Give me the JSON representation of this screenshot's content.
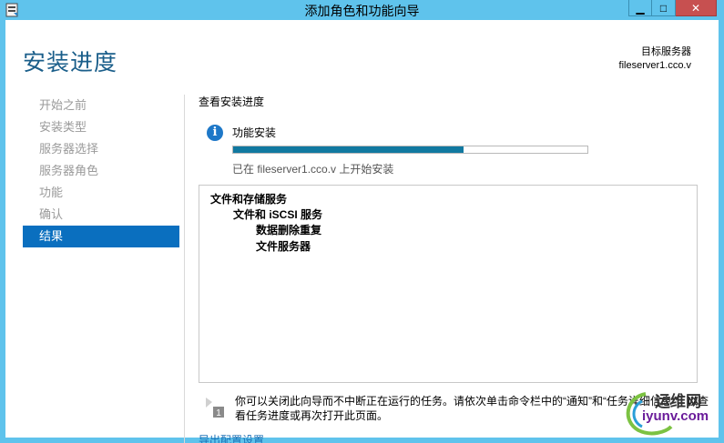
{
  "window": {
    "title": "添加角色和功能向导",
    "minimize_glyph": "▁",
    "maximize_glyph": "□",
    "close_glyph": "✕"
  },
  "header": {
    "page_title": "安装进度",
    "target_label": "目标服务器",
    "target_server": "fileserver1.cco.v"
  },
  "sidebar": {
    "items": [
      {
        "label": "开始之前",
        "active": false
      },
      {
        "label": "安装类型",
        "active": false
      },
      {
        "label": "服务器选择",
        "active": false
      },
      {
        "label": "服务器角色",
        "active": false
      },
      {
        "label": "功能",
        "active": false
      },
      {
        "label": "确认",
        "active": false
      },
      {
        "label": "结果",
        "active": true
      }
    ]
  },
  "main": {
    "section_title": "查看安装进度",
    "info_icon_glyph": "i",
    "progress_label": "功能安装",
    "progress_fraction": 0.65,
    "progress_status": "已在 fileserver1.cco.v 上开始安装",
    "features": [
      {
        "label": "文件和存储服务",
        "level": 0
      },
      {
        "label": "文件和 iSCSI 服务",
        "level": 1
      },
      {
        "label": "数据删除重复",
        "level": 2
      },
      {
        "label": "文件服务器",
        "level": 2
      }
    ],
    "note": "你可以关闭此向导而不中断正在运行的任务。请依次单击命令栏中的“通知”和“任务详细信息”，以查看任务进度或再次打开此页面。",
    "flag_number": "1",
    "export_link": "导出配置设置"
  },
  "watermark": {
    "cn": "运维网",
    "en": "iyunv.com"
  },
  "colors": {
    "titlebar": "#5fc3ec",
    "accent": "#0a6fbf",
    "progress": "#1179a0",
    "title_text": "#1a5e8a"
  }
}
